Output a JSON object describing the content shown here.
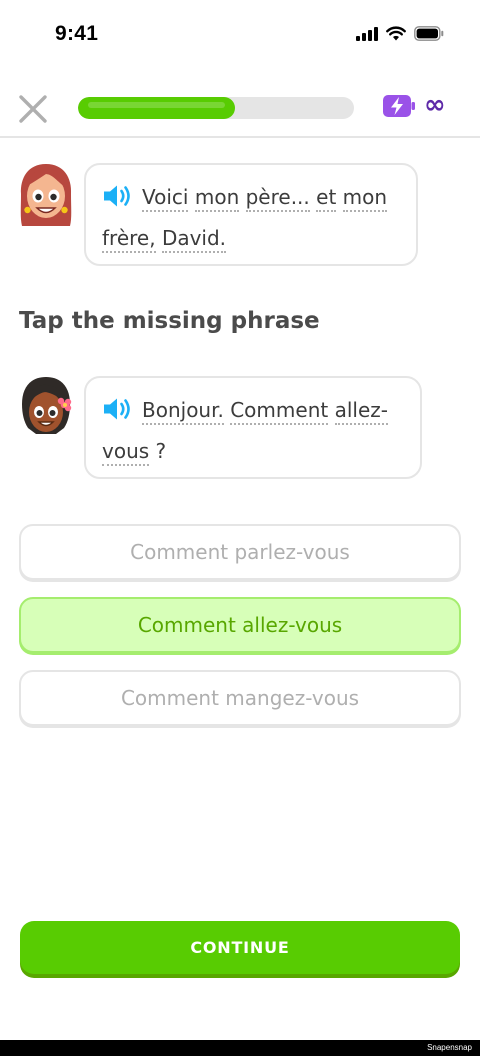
{
  "status_bar": {
    "time": "9:41",
    "icons": [
      "signal-icon",
      "wifi-icon",
      "battery-icon"
    ]
  },
  "lesson": {
    "progress_fraction": 0.57,
    "energy_icon": "energy-bolt-icon",
    "energy_value": "∞",
    "close_icon": "close-icon"
  },
  "dialog": [
    {
      "speaker": "woman-red-hair",
      "words": [
        "Voici",
        "mon",
        "père...",
        "et",
        "mon",
        "frère,",
        "David."
      ]
    },
    {
      "speaker": "woman-dark-hair-flower",
      "words": [
        "Bonjour.",
        "Comment",
        "allez-",
        "vous",
        "?"
      ]
    }
  ],
  "prompt": "Tap the missing phrase",
  "options": [
    {
      "label": "Comment parlez-vous",
      "selected": false
    },
    {
      "label": "Comment allez-vous",
      "selected": true
    },
    {
      "label": "Comment mangez-vous",
      "selected": false
    }
  ],
  "continue_label": "CONTINUE",
  "watermark": "Snapensnap",
  "colors": {
    "primary_green": "#58cc02",
    "selected_bg": "#d7ffb8",
    "selected_text": "#58a700",
    "speaker_blue": "#1cb0f6",
    "energy_purple": "#9a52e8",
    "infinity_purple": "#5e2aa8"
  }
}
